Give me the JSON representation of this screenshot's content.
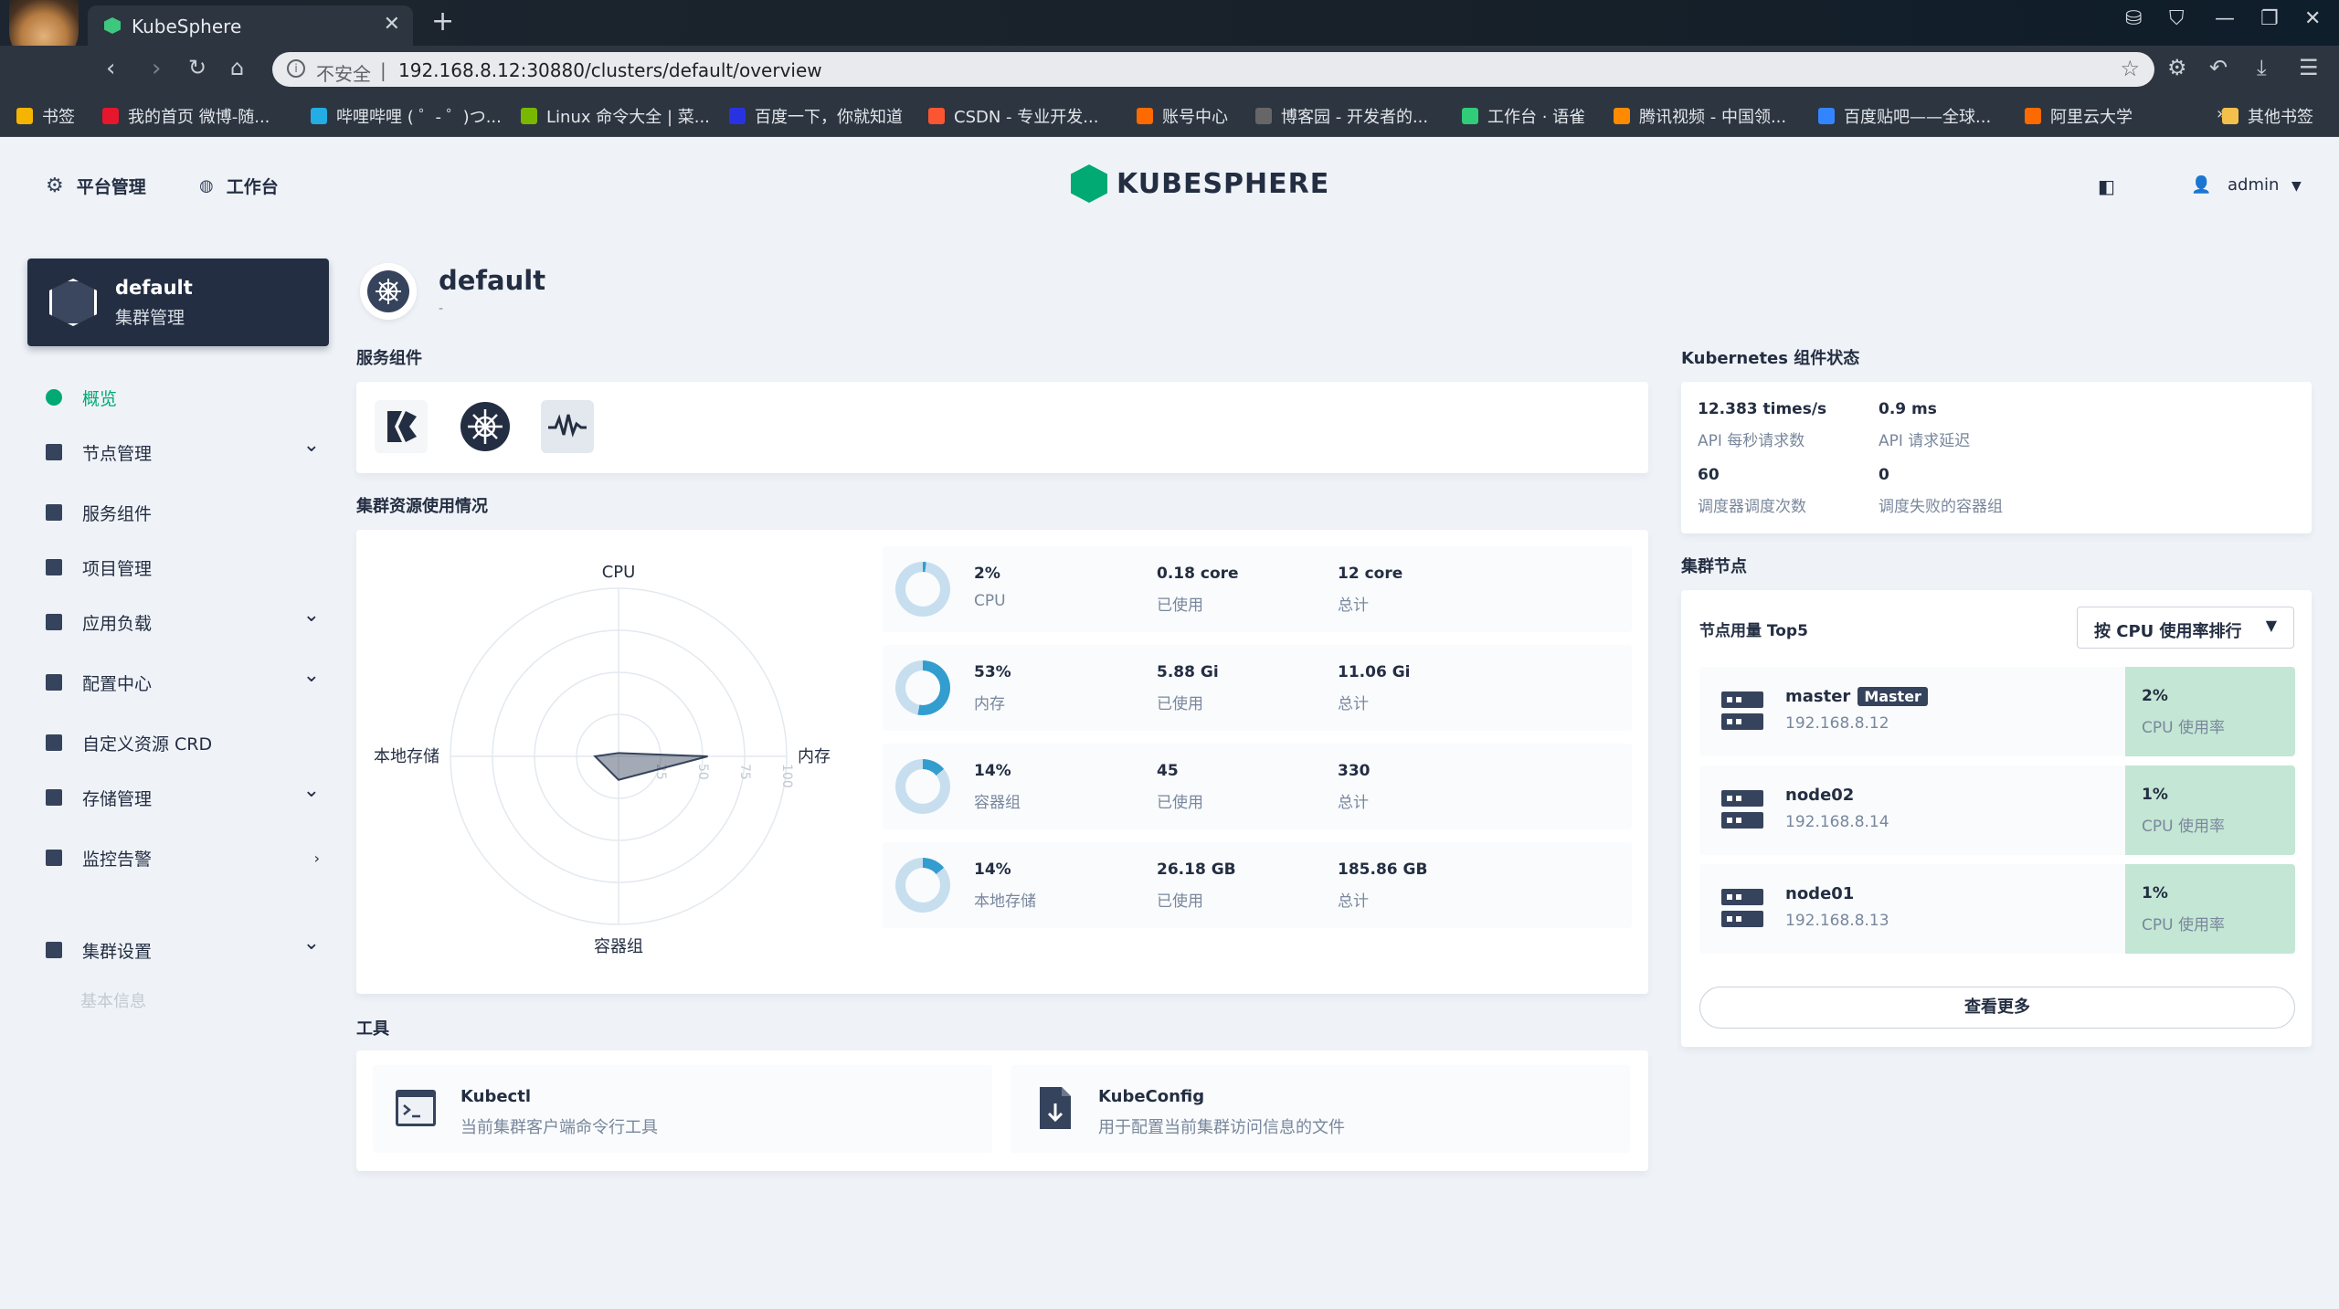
{
  "browser": {
    "tab_title": "KubeSphere",
    "url_insecure": "不安全",
    "url_sep": "|",
    "url": "192.168.8.12:30880/clusters/default/overview",
    "bookmarks": [
      {
        "label": "书签",
        "color": "#f5b400"
      },
      {
        "label": "我的首页 微博-随...",
        "color": "#e6162d"
      },
      {
        "label": "哔哩哔哩 ( ゜- ゜)つ...",
        "color": "#23ade5"
      },
      {
        "label": "Linux 命令大全 | 菜...",
        "color": "#7ab800"
      },
      {
        "label": "百度一下，你就知道",
        "color": "#2932e1"
      },
      {
        "label": "CSDN - 专业开发...",
        "color": "#fc5531"
      },
      {
        "label": "账号中心",
        "color": "#ff6a00"
      },
      {
        "label": "博客园 - 开发者的...",
        "color": "#666666"
      },
      {
        "label": "工作台 · 语雀",
        "color": "#31cc79"
      },
      {
        "label": "腾讯视频 - 中国领...",
        "color": "#ff8a00"
      },
      {
        "label": "百度贴吧——全球...",
        "color": "#3385ff"
      },
      {
        "label": "阿里云大学",
        "color": "#ff6a00"
      }
    ],
    "more_bookmarks": "»",
    "other_bookmarks": "其他书签"
  },
  "header": {
    "platform": "平台管理",
    "workbench": "工作台",
    "logo_text": "KUBESPHERE",
    "user": "admin"
  },
  "sidebar": {
    "cluster_name": "default",
    "cluster_sub": "集群管理",
    "items": [
      {
        "label": "概览",
        "active": true
      },
      {
        "label": "节点管理",
        "chevron": "down"
      },
      {
        "label": "服务组件"
      },
      {
        "label": "项目管理"
      },
      {
        "label": "应用负载",
        "chevron": "down"
      },
      {
        "label": "配置中心",
        "chevron": "down"
      },
      {
        "label": "自定义资源 CRD"
      },
      {
        "label": "存储管理",
        "chevron": "down"
      },
      {
        "label": "监控告警",
        "chevron": "right"
      },
      {
        "label": "集群设置",
        "chevron": "down"
      }
    ],
    "sub_item": "基本信息"
  },
  "main": {
    "title": "default",
    "desc": "-",
    "service_components_title": "服务组件",
    "resource_title": "集群资源使用情况",
    "tools_title": "工具",
    "radar": {
      "axes": [
        "CPU",
        "内存",
        "容器组",
        "本地存储"
      ],
      "ticks": [
        "25",
        "50",
        "75",
        "100"
      ],
      "values": [
        2,
        53,
        14,
        14
      ]
    },
    "resources": [
      {
        "pct": "2%",
        "name": "CPU",
        "used": "0.18 core",
        "used_lbl": "已使用",
        "total": "12 core",
        "total_lbl": "总计",
        "fraction": 0.02
      },
      {
        "pct": "53%",
        "name": "内存",
        "used": "5.88 Gi",
        "used_lbl": "已使用",
        "total": "11.06 Gi",
        "total_lbl": "总计",
        "fraction": 0.53
      },
      {
        "pct": "14%",
        "name": "容器组",
        "used": "45",
        "used_lbl": "已使用",
        "total": "330",
        "total_lbl": "总计",
        "fraction": 0.14
      },
      {
        "pct": "14%",
        "name": "本地存储",
        "used": "26.18 GB",
        "used_lbl": "已使用",
        "total": "185.86 GB",
        "total_lbl": "总计",
        "fraction": 0.14
      }
    ],
    "tools": [
      {
        "name": "Kubectl",
        "desc": "当前集群客户端命令行工具"
      },
      {
        "name": "KubeConfig",
        "desc": "用于配置当前集群访问信息的文件"
      }
    ]
  },
  "right": {
    "k8s_title": "Kubernetes 组件状态",
    "api_rate": "12.383 times/s",
    "api_rate_lbl": "API 每秒请求数",
    "api_latency": "0.9 ms",
    "api_latency_lbl": "API 请求延迟",
    "sched_count": "60",
    "sched_count_lbl": "调度器调度次数",
    "sched_fail": "0",
    "sched_fail_lbl": "调度失败的容器组",
    "nodes_title": "集群节点",
    "top5_label": "节点用量 Top5",
    "sort_select": "按 CPU 使用率排行",
    "nodes": [
      {
        "name": "master",
        "badge": "Master",
        "ip": "192.168.8.12",
        "cpu": "2%",
        "cpu_lbl": "CPU 使用率"
      },
      {
        "name": "node02",
        "ip": "192.168.8.14",
        "cpu": "1%",
        "cpu_lbl": "CPU 使用率"
      },
      {
        "name": "node01",
        "ip": "192.168.8.13",
        "cpu": "1%",
        "cpu_lbl": "CPU 使用率"
      }
    ],
    "view_more": "查看更多"
  },
  "colors": {
    "accent": "#00aa72",
    "dark": "#242e42",
    "donut_fill": "#329dce",
    "donut_track": "#c7deef",
    "node_cpu_bg": "#c4e6d4"
  }
}
